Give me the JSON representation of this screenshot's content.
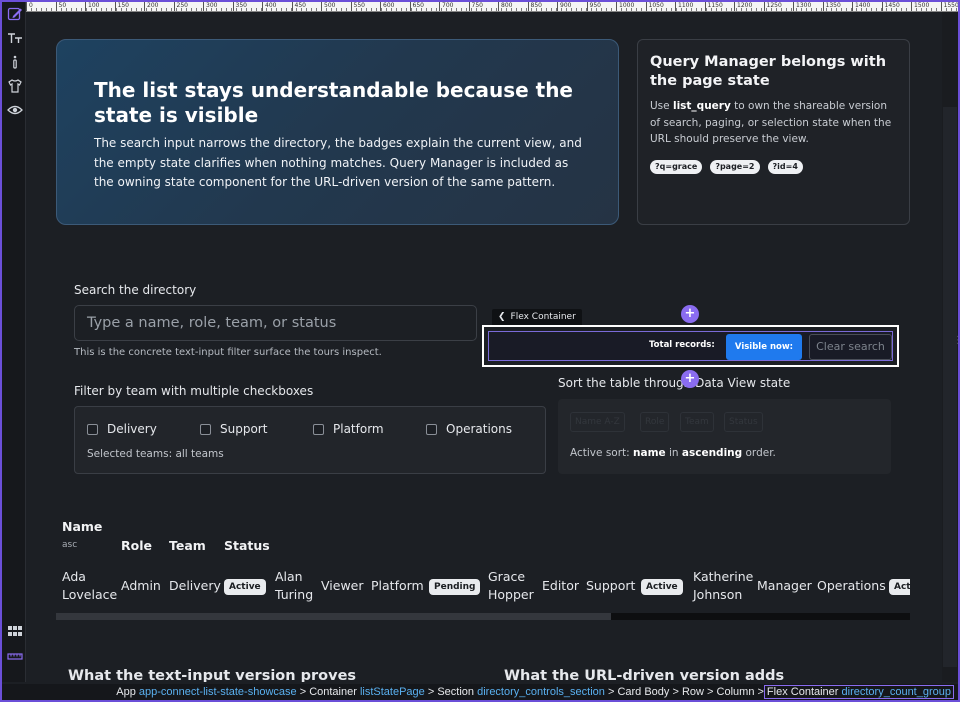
{
  "ruler": {
    "labels": [
      "0",
      "50",
      "100",
      "150",
      "200",
      "250",
      "300",
      "350",
      "400",
      "450",
      "500",
      "550",
      "600",
      "650",
      "700",
      "750",
      "800",
      "850",
      "900",
      "950",
      "1000",
      "1050",
      "1100",
      "1150",
      "1200",
      "1250",
      "1300",
      "1350",
      "1400",
      "1450",
      "1500",
      "1550"
    ]
  },
  "hero": {
    "title": "The list stays understandable because the state is visible",
    "body": "The search input narrows the directory, the badges explain the current view, and the empty state clarifies when nothing matches. Query Manager is included as the owning state component for the URL-driven version of the same pattern."
  },
  "side_card": {
    "title": "Query Manager belongs with the page state",
    "body_prefix": "Use ",
    "body_code": "list_query",
    "body_suffix": " to own the shareable version of search, paging, or selection state when the URL should preserve the view.",
    "chips": [
      "?q=grace",
      "?page=2",
      "?id=4"
    ]
  },
  "search": {
    "label": "Search the directory",
    "placeholder": "Type a name, role, team, or status",
    "helper": "This is the concrete text-input filter surface the tours inspect."
  },
  "flex_overlay": {
    "tag": "Flex Container",
    "total_label": "Total records:",
    "visible_label": "Visible now:",
    "clear_label": "Clear search",
    "plus": "+"
  },
  "filter": {
    "label": "Filter by team with multiple checkboxes",
    "teams": [
      "Delivery",
      "Support",
      "Platform",
      "Operations"
    ],
    "selected": "Selected teams: all teams"
  },
  "sort": {
    "label": "Sort the table through Data View state",
    "buttons": [
      "Name A-Z",
      "Role",
      "Team",
      "Status"
    ],
    "active_prefix": "Active sort: ",
    "active_field": "name",
    "active_mid": " in ",
    "active_order": "ascending",
    "active_suffix": " order."
  },
  "table": {
    "headers": {
      "name": "Name",
      "name_sub": "asc",
      "role": "Role",
      "team": "Team",
      "status": "Status"
    },
    "rows": [
      {
        "name1": "Ada",
        "name2": "Lovelace",
        "role": "Admin",
        "team": "Delivery",
        "status": "Active"
      },
      {
        "name1": "Alan",
        "name2": "Turing",
        "role": "Viewer",
        "team": "Platform",
        "status": "Pending"
      },
      {
        "name1": "Grace",
        "name2": "Hopper",
        "role": "Editor",
        "team": "Support",
        "status": "Active"
      },
      {
        "name1": "Katherine",
        "name2": "Johnson",
        "role": "Manager",
        "team": "Operations",
        "status": "Act"
      }
    ]
  },
  "bottom": {
    "left_heading": "What the text-input version proves",
    "right_heading": "What the URL-driven version adds"
  },
  "breadcrumb": {
    "app": "App",
    "app_name": "app-connect-list-state-showcase",
    "container": "Container",
    "container_name": "listStatePage",
    "section": "Section",
    "section_name": "directory_controls_section",
    "card": "Card Body",
    "row": "Row",
    "column": "Column",
    "current": "Flex Container",
    "current_name": "directory_count_group"
  },
  "colors": {
    "accent": "#6b4fd8",
    "primary": "#1f7aee",
    "link": "#5ab0f0"
  }
}
